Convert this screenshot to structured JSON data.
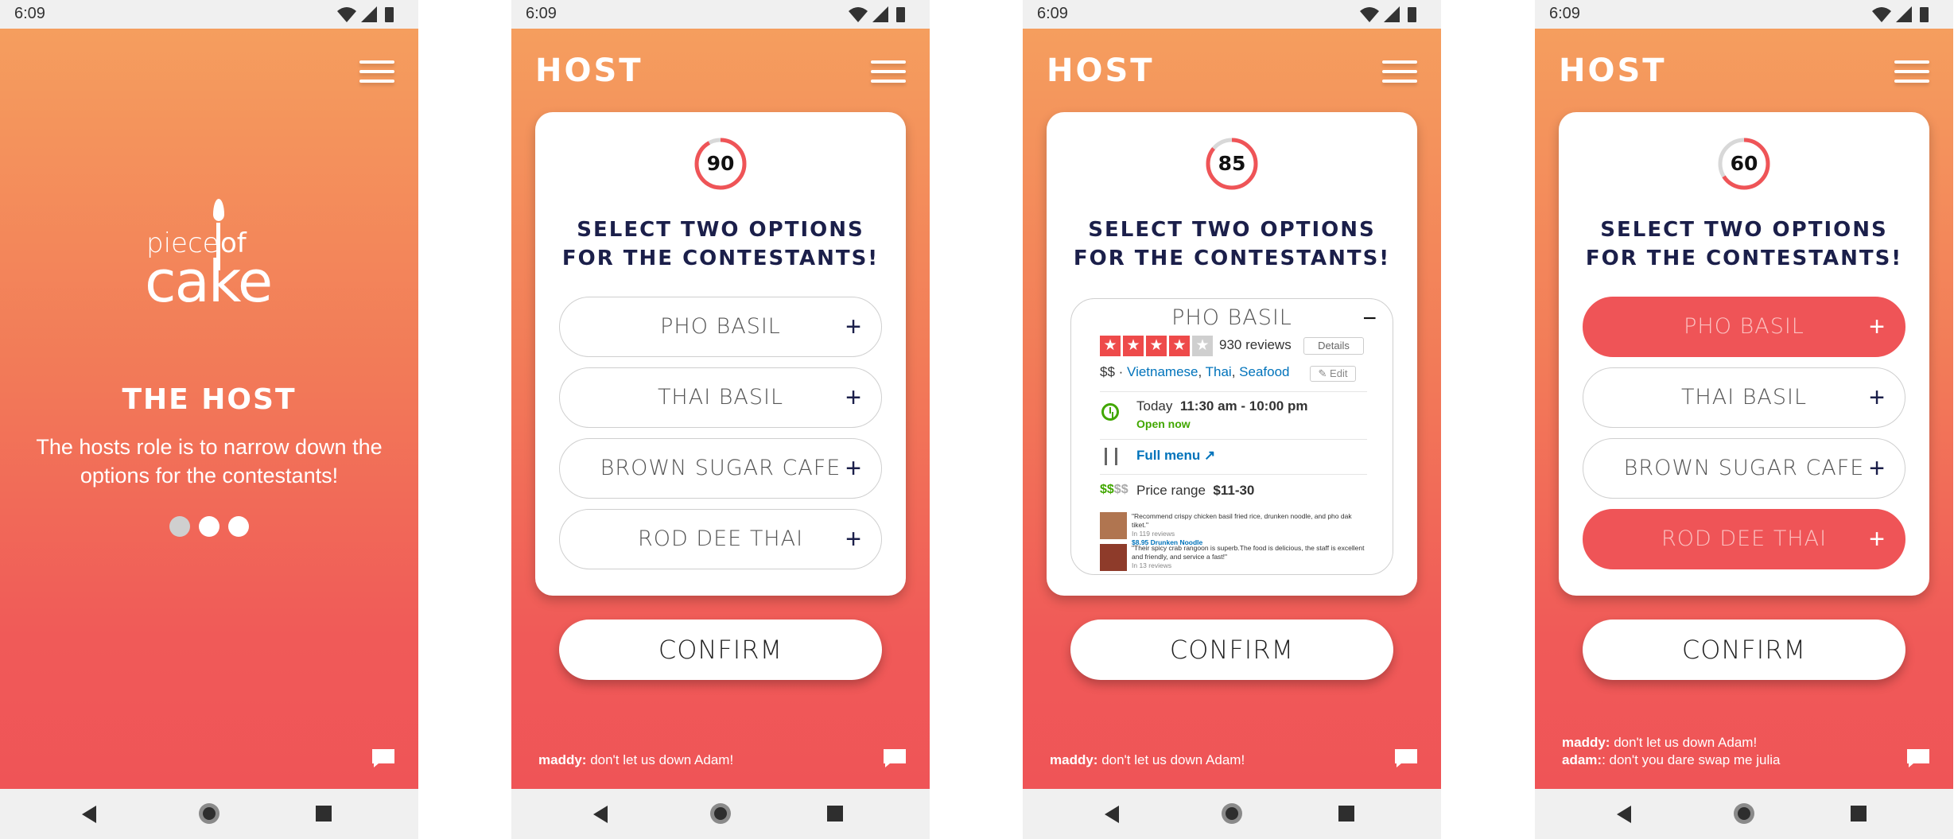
{
  "status": {
    "time": "6:09"
  },
  "screen1": {
    "logo": {
      "piece": "piece",
      "of": "of",
      "cake": "cake"
    },
    "heading": "THE HOST",
    "description": "The hosts role is to narrow down the options for the contestants!"
  },
  "host": {
    "title": "HOST",
    "card_title_line1": "SELECT TWO OPTIONS",
    "card_title_line2": "FOR THE CONTESTANTS!",
    "confirm": "CONFIRM"
  },
  "screen2": {
    "timer": "90",
    "timer_progress": 0.92,
    "options": [
      "PHO BASIL",
      "THAI BASIL",
      "BROWN SUGAR CAFE",
      "ROD DEE THAI"
    ],
    "chat": [
      {
        "user": "maddy:",
        "text": " don't let us down Adam!"
      }
    ]
  },
  "screen3": {
    "timer": "85",
    "timer_progress": 0.86,
    "expanded_option": "PHO BASIL",
    "rating": 4,
    "reviews": "930 reviews",
    "details_label": "Details",
    "price": "$$",
    "categories": [
      "Vietnamese",
      "Thai",
      "Seafood"
    ],
    "edit_label": "Edit",
    "hours_today": "Today",
    "hours_time": "11:30 am - 10:00 pm",
    "open_status": "Open now",
    "full_menu": "Full menu",
    "price_range_dollars_on": "$$",
    "price_range_dollars_off": "$$",
    "price_range_label": "Price range",
    "price_range_value": "$11-30",
    "review1": "\"Recommend crispy chicken basil fried rice, drunken noodle, and pho dak tiket.\"",
    "review1_meta": "In 119 reviews",
    "review1_link": "$8.95 Drunken Noodle",
    "review2": "\"Their spicy crab rangoon is superb.The food is delicious, the staff is excellent and friendly, and service a fast!\"",
    "review2_meta": "In 13 reviews",
    "chat": [
      {
        "user": "maddy:",
        "text": " don't let us down Adam!"
      }
    ]
  },
  "screen4": {
    "timer": "60",
    "timer_progress": 0.66,
    "options": [
      "PHO BASIL",
      "THAI BASIL",
      "BROWN SUGAR CAFE",
      "ROD DEE THAI"
    ],
    "selected": [
      true,
      false,
      false,
      true
    ],
    "chat": [
      {
        "user": "maddy:",
        "text": " don't let us down Adam!"
      },
      {
        "user": "adam:",
        "text": ": don't you dare swap me julia"
      }
    ]
  },
  "colors": {
    "accent": "#ef5457",
    "gradient_top": "#f59e5e",
    "navy": "#1b1f4a"
  },
  "icons": [
    "hamburger-menu-icon",
    "chat-icon",
    "wifi-icon",
    "signal-icon",
    "battery-icon",
    "back-icon",
    "home-icon",
    "recents-icon"
  ]
}
